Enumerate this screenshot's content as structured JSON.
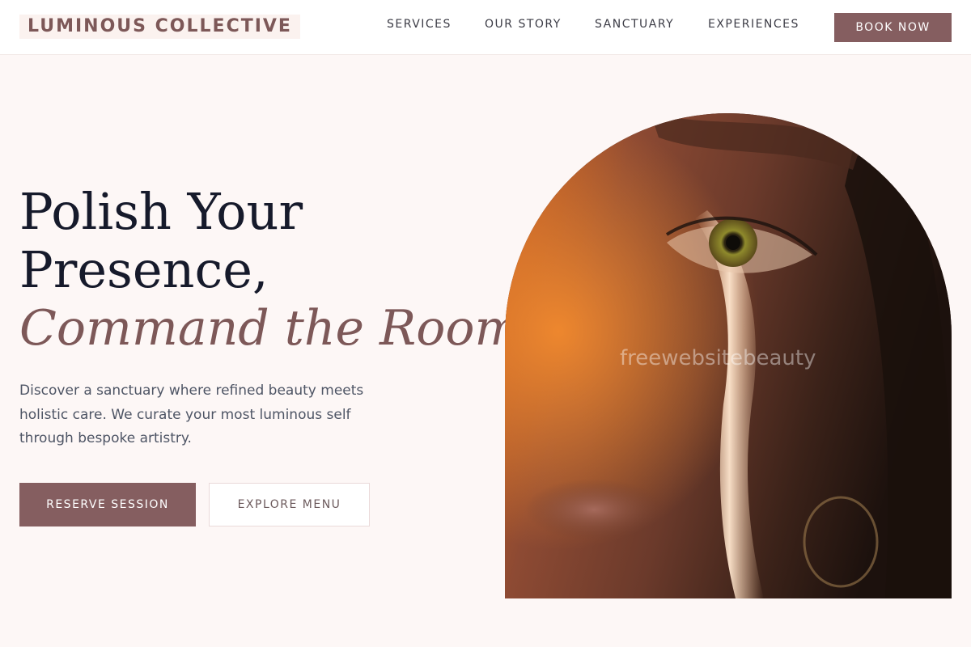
{
  "brand": {
    "logo_text": "LUMINOUS COLLECTIVE"
  },
  "nav": {
    "items": [
      {
        "label": "SERVICES"
      },
      {
        "label": "OUR STORY"
      },
      {
        "label": "SANCTUARY"
      },
      {
        "label": "EXPERIENCES"
      }
    ],
    "cta_label": "BOOK NOW"
  },
  "hero": {
    "headline_line1": "Polish Your",
    "headline_line2": "Presence,",
    "headline_accent": "Command the Room.",
    "description": "Discover a sanctuary where refined beauty meets holistic care. We curate your most luminous self through bespoke artistry.",
    "primary_button": "RESERVE SESSION",
    "secondary_button": "EXPLORE MENU",
    "image": {
      "subject": "close-up portrait of a woman's face with a beam of warm light",
      "watermark": "freewebsitebeauty"
    }
  },
  "colors": {
    "page_background": "#fdf7f6",
    "header_background": "#ffffff",
    "accent": "#855e60",
    "headline_text": "#161a2b",
    "accent_text": "#7d5858",
    "body_text": "#4e5565"
  },
  "icons": []
}
